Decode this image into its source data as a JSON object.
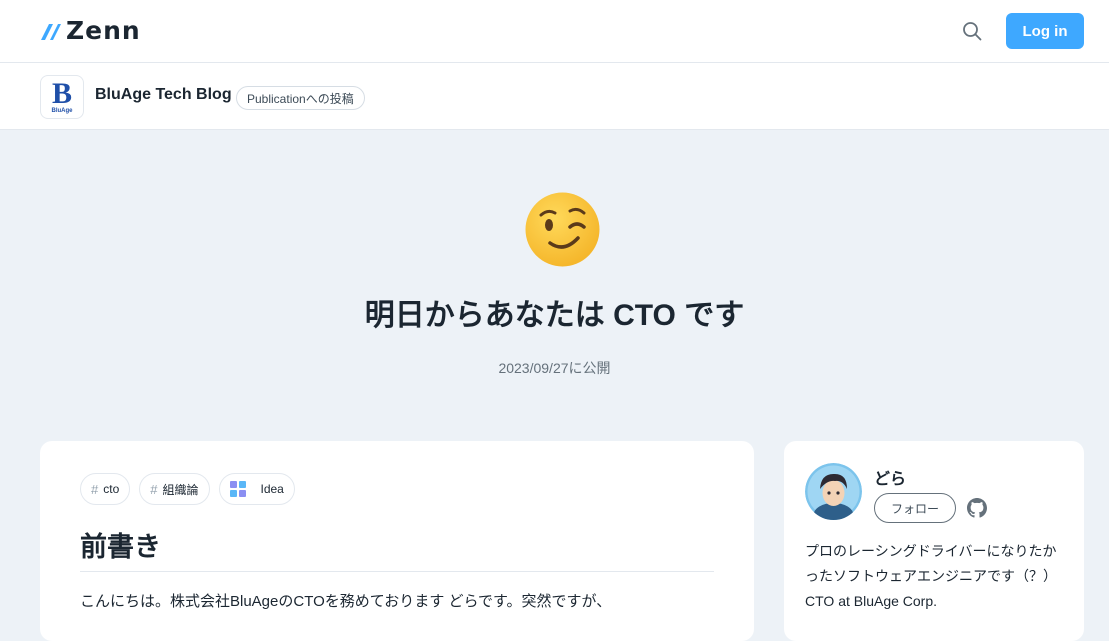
{
  "header": {
    "logo_text": "Zenn",
    "search_icon": "search-icon",
    "login_label": "Log in",
    "accent": "#3ea8ff"
  },
  "publication": {
    "logo_mark": "B",
    "logo_sub": "BluAge",
    "name": "BluAge Tech Blog",
    "badge": "Publicationへの投稿"
  },
  "article": {
    "emoji": "winking-face",
    "title": "明日からあなたは CTO です",
    "published": "2023/09/27に公開",
    "tags": [
      {
        "prefix": "#",
        "label": "cto"
      },
      {
        "prefix": "#",
        "label": "組織論"
      },
      {
        "prefix": "",
        "label": "Idea",
        "icon": "idea-icon"
      }
    ],
    "heading": "前書き",
    "intro": "こんにちは。株式会社BluAgeのCTOを務めております どらです。突然ですが、"
  },
  "author": {
    "name": "どら",
    "follow_label": "フォロー",
    "github_icon": "github-icon",
    "bio": "プロのレーシングドライバーになりたかったソフトウェアエンジニアです（？） CTO at BluAge Corp."
  }
}
